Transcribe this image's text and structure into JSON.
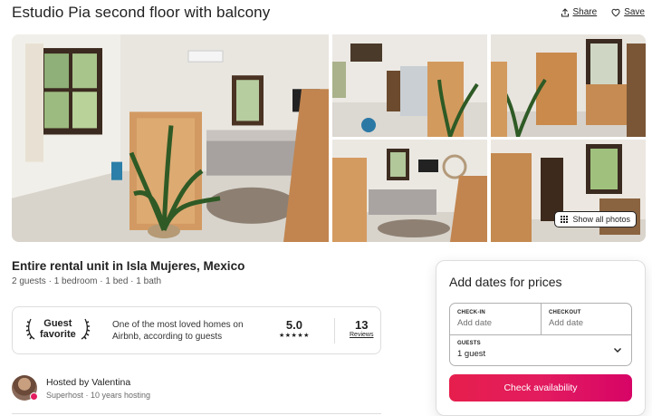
{
  "listing": {
    "title": "Estudio Pia second floor with balcony",
    "subtitle": "Entire rental unit in Isla Mujeres, Mexico",
    "details": "2 guests · 1 bedroom · 1 bed · 1 bath"
  },
  "header": {
    "share_label": "Share",
    "save_label": "Save"
  },
  "gallery": {
    "show_all_label": "Show all photos"
  },
  "guest_favorite": {
    "badge_line1": "Guest",
    "badge_line2": "favorite",
    "description": "One of the most loved homes on Airbnb, according to guests",
    "rating": "5.0",
    "stars": "★★★★★",
    "reviews_count": "13",
    "reviews_label": "Reviews"
  },
  "host": {
    "name": "Hosted by Valentina",
    "meta": "Superhost · 10 years hosting"
  },
  "booking": {
    "title": "Add dates for prices",
    "checkin_label": "CHECK-IN",
    "checkin_placeholder": "Add date",
    "checkout_label": "CHECKOUT",
    "checkout_placeholder": "Add date",
    "guests_label": "GUESTS",
    "guests_value": "1 guest",
    "button_label": "Check availability"
  },
  "colors": {
    "brand": "#e31c5f",
    "text": "#222222",
    "muted": "#717171",
    "border": "#dddddd"
  },
  "icons": {
    "share": "share-icon",
    "save": "heart-icon",
    "show_all": "grid-dots-icon",
    "laurel": "laurel-icon",
    "chevron": "chevron-down-icon"
  }
}
